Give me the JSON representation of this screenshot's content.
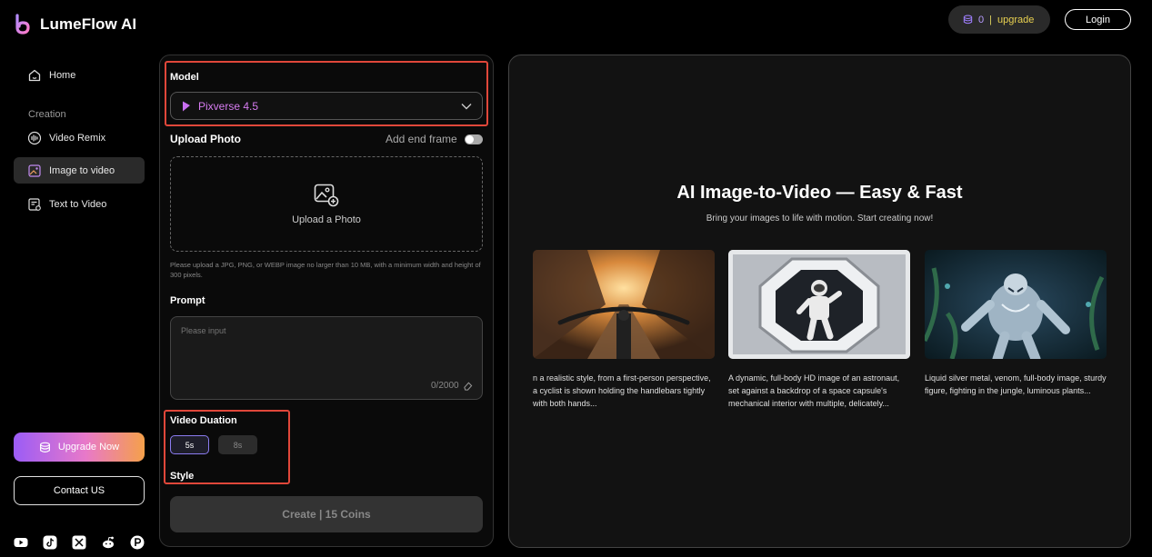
{
  "brand": {
    "name": "LumeFlow AI"
  },
  "header": {
    "coins": "0",
    "separator": "|",
    "upgrade_link": "upgrade",
    "login": "Login"
  },
  "sidebar": {
    "home": "Home",
    "section_label": "Creation",
    "items": [
      {
        "label": "Video Remix",
        "icon": "waveform-icon"
      },
      {
        "label": "Image to video",
        "icon": "image-video-icon"
      },
      {
        "label": "Text to Video",
        "icon": "text-video-icon"
      }
    ],
    "upgrade_button": "Upgrade Now",
    "contact_button": "Contact US",
    "social": [
      "youtube-icon",
      "tiktok-icon",
      "x-icon",
      "reddit-icon",
      "p-icon"
    ]
  },
  "form": {
    "model_label": "Model",
    "model_value": "Pixverse 4.5",
    "upload_label": "Upload Photo",
    "end_frame_label": "Add end frame",
    "upload_text": "Upload a Photo",
    "upload_hint": "Please upload a JPG, PNG, or WEBP image no larger than 10 MB, with a minimum width and height of 300 pixels.",
    "prompt_label": "Prompt",
    "prompt_placeholder": "Please input",
    "prompt_counter": "0/2000",
    "duration_label": "Video Duation",
    "duration_options": [
      "5s",
      "8s"
    ],
    "style_label": "Style",
    "create_button": "Create | 15 Coins"
  },
  "preview": {
    "title": "AI Image-to-Video — Easy & Fast",
    "subtitle": "Bring your images to life with motion. Start creating now!",
    "cards": [
      {
        "text": "n a realistic style, from a first-person perspective, a cyclist is shown holding the handlebars tightly with both hands..."
      },
      {
        "text": "A dynamic, full-body HD image of an astronaut, set against a backdrop of a space capsule's mechanical interior with multiple, delicately..."
      },
      {
        "text": "Liquid silver metal, venom, full-body image, sturdy figure, fighting in the jungle, luminous plants..."
      }
    ]
  },
  "colors": {
    "accent_purple": "#9b5cf6",
    "accent_orange": "#f5a04a",
    "model_text": "#d67cf0",
    "highlight_red": "#e0473a"
  }
}
